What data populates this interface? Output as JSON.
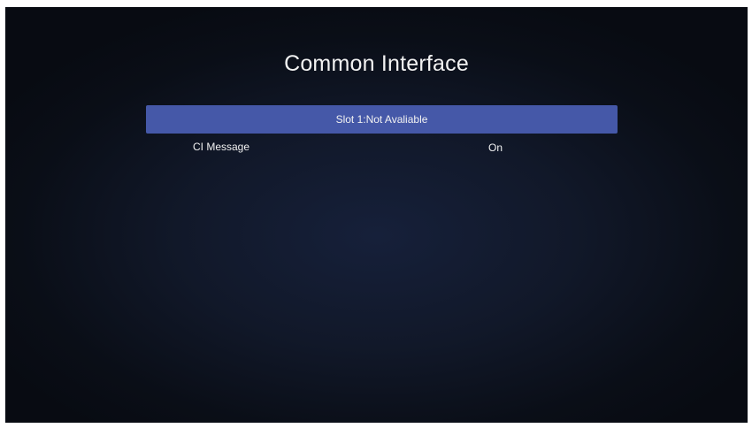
{
  "header": {
    "title": "Common Interface"
  },
  "menu": {
    "slot": {
      "label": "Slot 1:Not Avaliable"
    },
    "ci_message": {
      "label": "CI Message",
      "value": "On"
    }
  },
  "colors": {
    "background": "#0e1424",
    "highlight": "#4558a8",
    "text": "#f2f2f2"
  }
}
